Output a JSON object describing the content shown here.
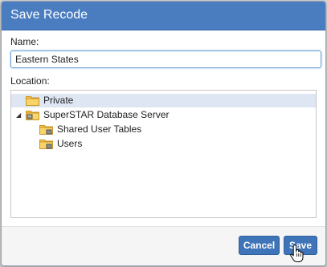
{
  "dialog": {
    "title": "Save Recode",
    "name_label": "Name:",
    "name_value": "Eastern States",
    "location_label": "Location:",
    "tree": [
      {
        "label": "Private",
        "level": 1,
        "selected": true,
        "icon": "folder-icon"
      },
      {
        "label": "SuperSTAR Database Server",
        "level": 0,
        "expanded": true,
        "icon": "server-folder-icon"
      },
      {
        "label": "Shared User Tables",
        "level": 2,
        "icon": "shared-folder-icon"
      },
      {
        "label": "Users",
        "level": 2,
        "icon": "shared-folder-icon"
      }
    ],
    "cancel_label": "Cancel",
    "save_label": "Save"
  },
  "colors": {
    "titlebar": "#4a7cc0",
    "button": "#3f74b8",
    "selection": "#dde6f2",
    "folder": "#f5c242"
  },
  "cursor_icon": "hand-pointer-icon"
}
